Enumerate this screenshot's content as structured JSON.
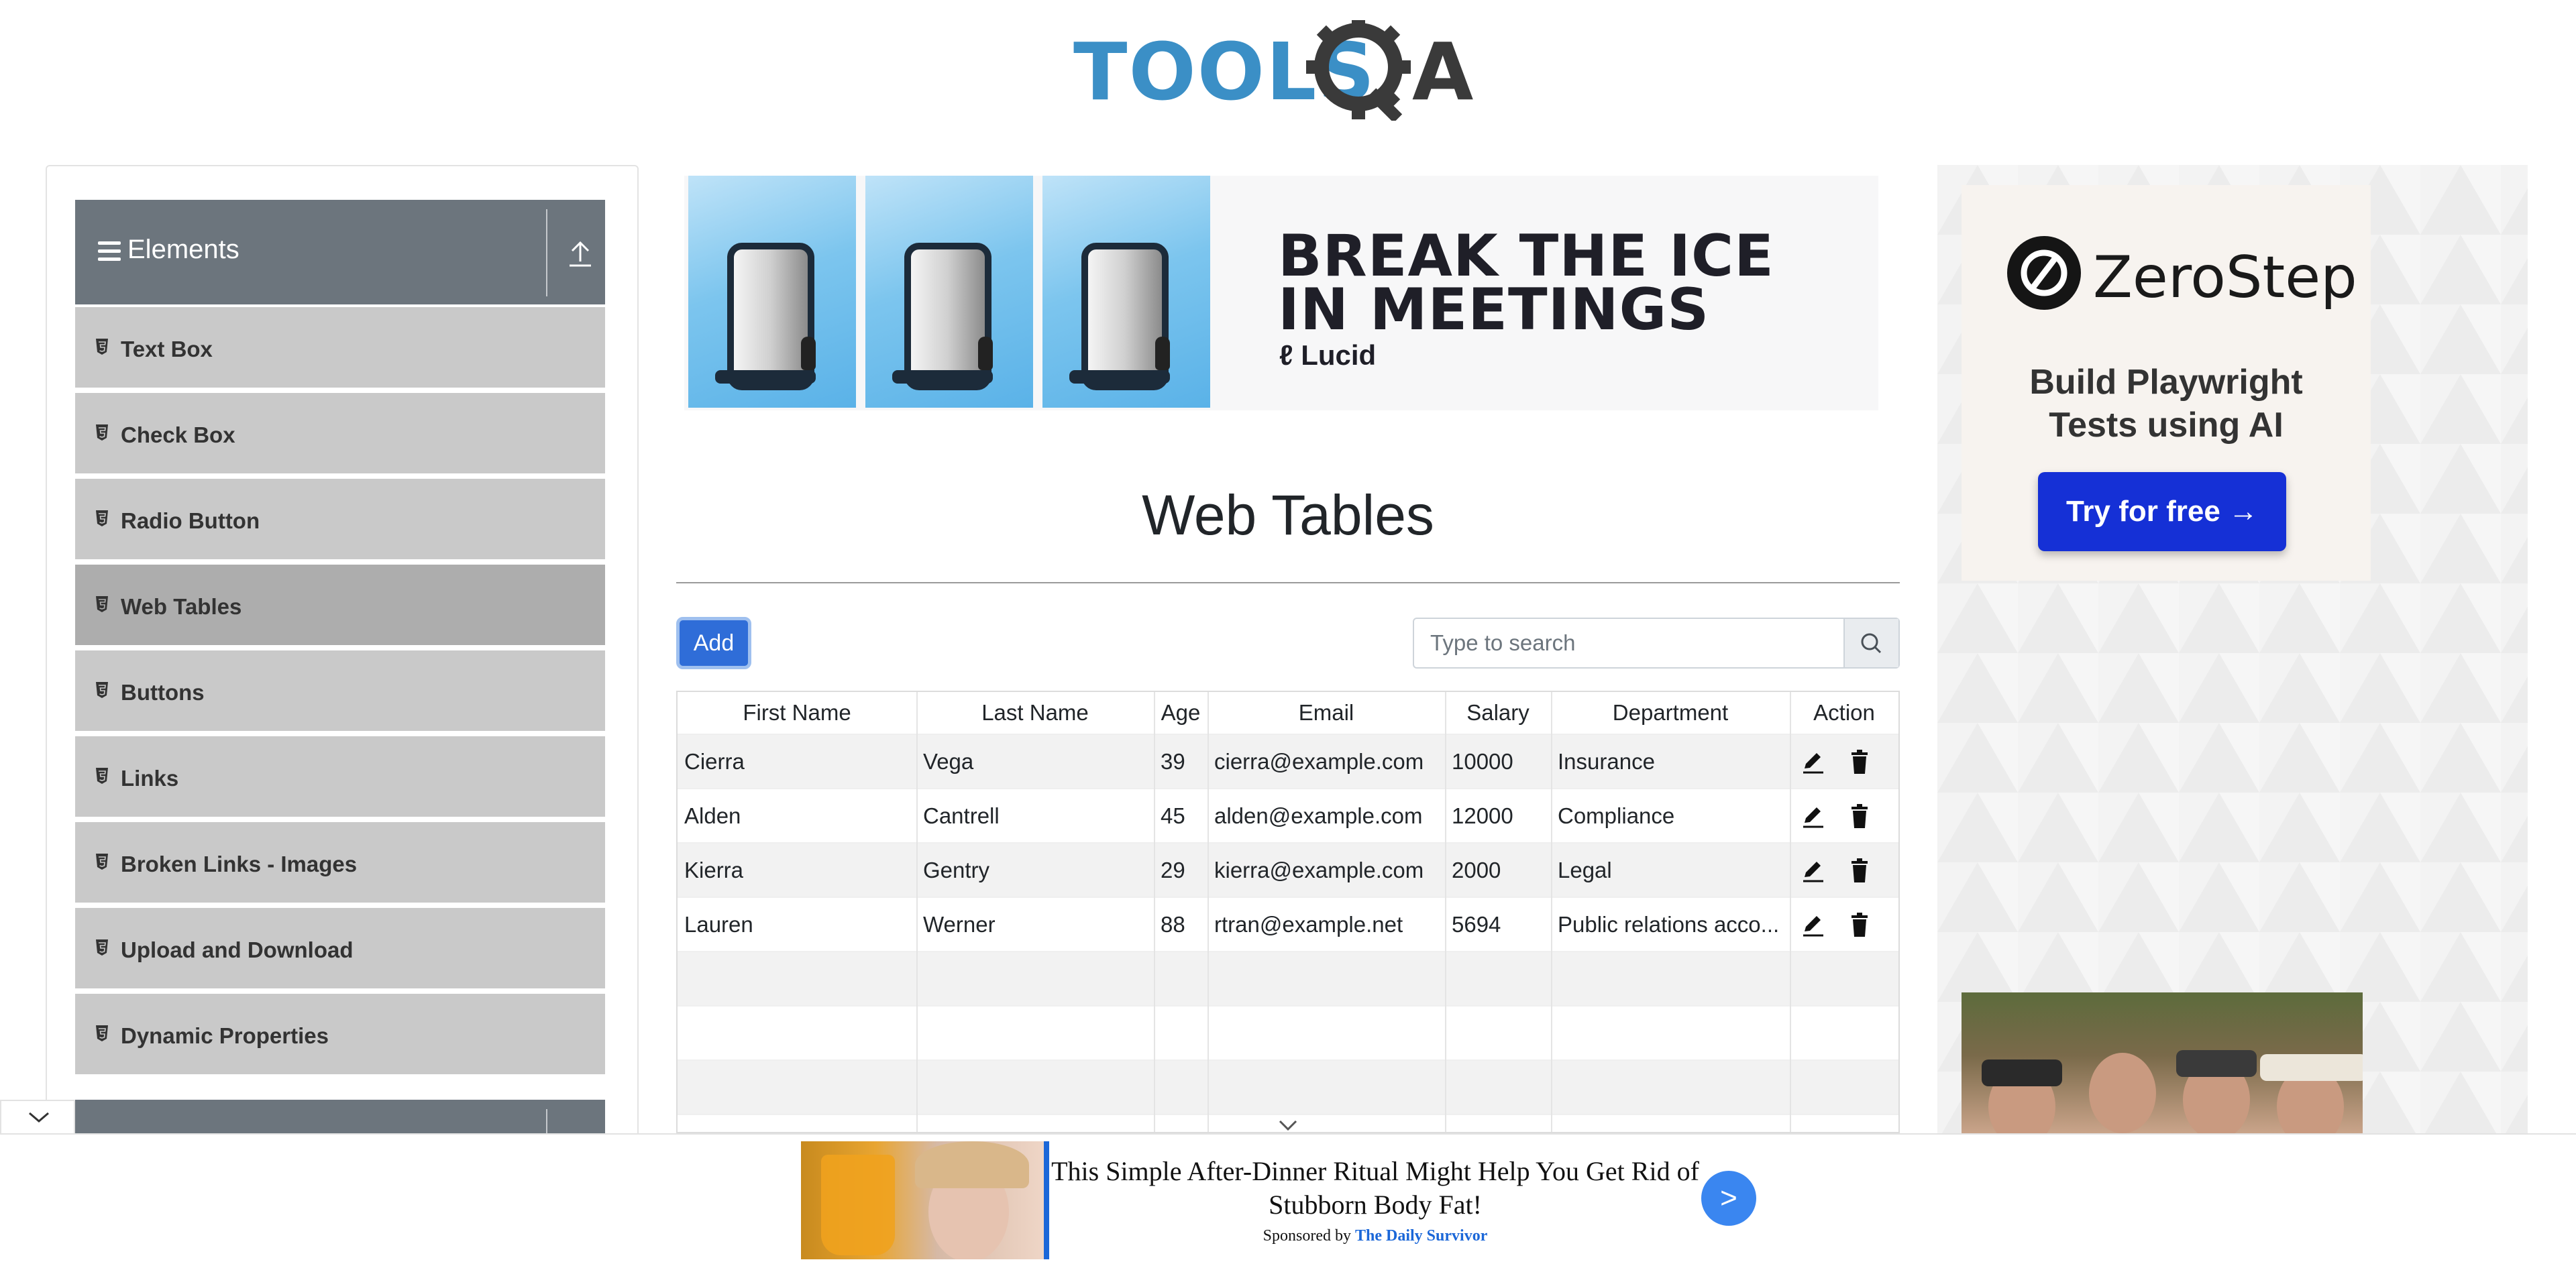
{
  "logo": {
    "text_tools": "TOOLS",
    "text_qa": "QA"
  },
  "sidebar": {
    "group_title": "Elements",
    "items": [
      {
        "label": "Text Box",
        "active": false
      },
      {
        "label": "Check Box",
        "active": false
      },
      {
        "label": "Radio Button",
        "active": false
      },
      {
        "label": "Web Tables",
        "active": true
      },
      {
        "label": "Buttons",
        "active": false
      },
      {
        "label": "Links",
        "active": false
      },
      {
        "label": "Broken Links - Images",
        "active": false
      },
      {
        "label": "Upload and Download",
        "active": false
      },
      {
        "label": "Dynamic Properties",
        "active": false
      }
    ]
  },
  "banner_ad": {
    "headline_1": "BREAK THE ICE",
    "headline_2": "IN MEETINGS",
    "brand": "Lucid"
  },
  "page": {
    "title": "Web Tables"
  },
  "toolbar": {
    "add_label": "Add"
  },
  "search": {
    "placeholder": "Type to search",
    "value": ""
  },
  "table": {
    "headers": [
      "First Name",
      "Last Name",
      "Age",
      "Email",
      "Salary",
      "Department",
      "Action"
    ],
    "rows": [
      [
        "Cierra",
        "Vega",
        "39",
        "cierra@example.com",
        "10000",
        "Insurance"
      ],
      [
        "Alden",
        "Cantrell",
        "45",
        "alden@example.com",
        "12000",
        "Compliance"
      ],
      [
        "Kierra",
        "Gentry",
        "29",
        "kierra@example.com",
        "2000",
        "Legal"
      ],
      [
        "Lauren",
        "Werner",
        "88",
        "rtran@example.net",
        "5694",
        "Public relations acco..."
      ]
    ],
    "empty_rows": 3
  },
  "right_ad": {
    "brand": "ZeroStep",
    "tagline_1": "Build Playwright",
    "tagline_2": "Tests using AI",
    "cta": "Try for free →"
  },
  "bottom_ad": {
    "title": "This Simple After-Dinner Ritual Might Help You Get Rid of Stubborn Body Fat!",
    "sponsored_by": "Sponsored by",
    "sponsor": "The Daily Survivor",
    "go": ">"
  },
  "colors": {
    "sidebar_header": "#6c757d",
    "sidebar_item": "#c9c9c9",
    "sidebar_item_active": "#adadad",
    "primary": "#2f6dd8",
    "zerostep_cta": "#1530d6"
  }
}
